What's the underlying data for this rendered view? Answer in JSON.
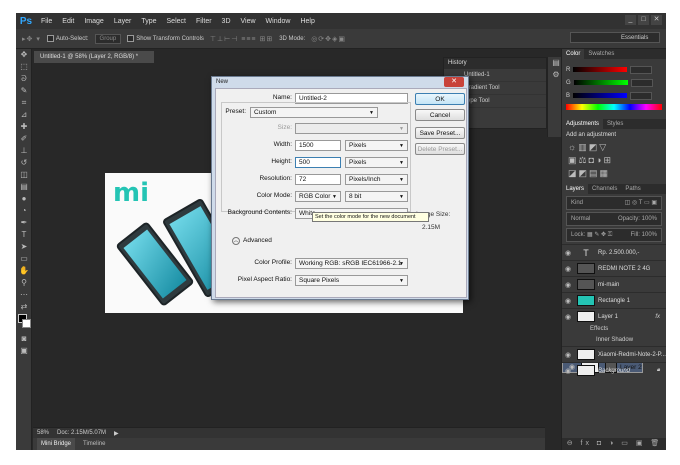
{
  "app": {
    "logo": "Ps",
    "menu": [
      "File",
      "Edit",
      "Image",
      "Layer",
      "Type",
      "Select",
      "Filter",
      "3D",
      "View",
      "Window",
      "Help"
    ],
    "window_controls": [
      "_",
      "□",
      "✕"
    ]
  },
  "options": {
    "auto_select_label": "Auto-Select:",
    "auto_select_value": "Group",
    "show_transform": "Show Transform Controls",
    "mode_3d": "3D Mode:",
    "workspace": "Essentials"
  },
  "document": {
    "tab": "Untitled-1 @ 58% (Layer 2, RGB/8) *",
    "zoom": "58%",
    "doc_info": "Doc: 2.15M/5.07M"
  },
  "bottom_tabs": [
    "Mini Bridge",
    "Timeline"
  ],
  "history": {
    "title": "History",
    "items": [
      "Untitled-1",
      "Gradient Tool",
      "Type Tool"
    ]
  },
  "color_panel": {
    "tabs": [
      "Color",
      "Swatches"
    ],
    "channels": [
      "R",
      "G",
      "B"
    ]
  },
  "adjustments": {
    "tabs": [
      "Adjustments",
      "Styles"
    ],
    "title": "Add an adjustment"
  },
  "layers_panel": {
    "tabs": [
      "Layers",
      "Channels",
      "Paths"
    ],
    "kind": "Kind",
    "blend": "Normal",
    "opacity_label": "Opacity:",
    "opacity": "100%",
    "lock_label": "Lock:",
    "fill_label": "Fill:",
    "fill": "100%",
    "layers": [
      "Rp. 2.500.000,-",
      "REDMI NOTE 2 4G",
      "mi-main",
      "Rectangle 1",
      "Layer 1",
      "Xiaomi-Redmi-Note-2-P...",
      "Layer 2",
      "Background"
    ],
    "effects": "Effects",
    "inner_shadow": "Inner Shadow",
    "fx": "fx"
  },
  "dialog": {
    "title": "New",
    "name_label": "Name:",
    "name_value": "Untitled-2",
    "preset_label": "Preset:",
    "preset_value": "Custom",
    "size_label": "Size:",
    "width_label": "Width:",
    "width_value": "1500",
    "width_unit": "Pixels",
    "height_label": "Height:",
    "height_value": "500",
    "height_unit": "Pixels",
    "resolution_label": "Resolution:",
    "resolution_value": "72",
    "resolution_unit": "Pixels/Inch",
    "color_mode_label": "Color Mode:",
    "color_mode_value": "RGB Color",
    "color_depth": "8 bit",
    "background_label": "Background Contents:",
    "background_value": "White",
    "advanced_label": "Advanced",
    "profile_label": "Color Profile:",
    "profile_value": "Working RGB: sRGB IEC61966-2.1",
    "aspect_label": "Pixel Aspect Ratio:",
    "aspect_value": "Square Pixels",
    "ok": "OK",
    "cancel": "Cancel",
    "save_preset": "Save Preset...",
    "delete_preset": "Delete Preset...",
    "image_size_label": "Image Size:",
    "image_size_value": "2.15M",
    "tooltip": "Set the color mode for the new document"
  }
}
